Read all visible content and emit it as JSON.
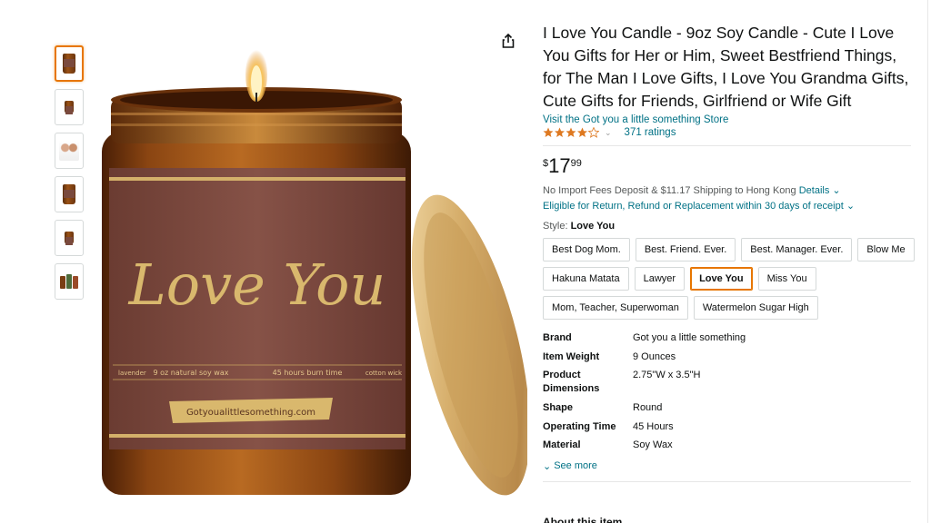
{
  "product": {
    "title": "I Love You Candle - 9oz Soy Candle - Cute I Love You Gifts for Her or Him, Sweet Bestfriend Things, for The Man I Love Gifts, I Love You Grandma Gifts, Cute Gifts for Friends, Girlfriend or Wife Gift",
    "store_link": "Visit the Got you a little something Store",
    "rating_value": 4.5,
    "ratings_count": "371 ratings",
    "price": {
      "currency": "$",
      "whole": "17",
      "fraction": "99"
    },
    "shipping_text": "No Import Fees Deposit & $11.17 Shipping to Hong Kong",
    "shipping_details_link": "Details",
    "returns_text": "Eligible for Return, Refund or Replacement within 30 days of receipt",
    "style_label": "Style:",
    "style_selected": "Love You",
    "style_options": [
      "Best Dog Mom.",
      "Best. Friend. Ever.",
      "Best. Manager. Ever.",
      "Blow Me",
      "Hakuna Matata",
      "Lawyer",
      "Love You",
      "Miss You",
      "Mom, Teacher, Superwoman",
      "Watermelon Sugar High"
    ],
    "specs": [
      {
        "key": "Brand",
        "value": "Got you a little something"
      },
      {
        "key": "Item Weight",
        "value": "9 Ounces"
      },
      {
        "key": "Product Dimensions",
        "value": "2.75\"W x 3.5\"H"
      },
      {
        "key": "Shape",
        "value": "Round"
      },
      {
        "key": "Operating Time",
        "value": "45 Hours"
      },
      {
        "key": "Material",
        "value": "Soy Wax"
      }
    ],
    "see_more": "See more",
    "cut_heading": "About this item"
  },
  "image": {
    "label_script": "Love You",
    "label_small_1": "lavender",
    "label_small_2": "9 oz natural soy wax",
    "label_small_3": "45 hours burn time",
    "label_small_4": "cotton wick",
    "label_website": "Gotyoualittlesomething.com"
  },
  "icons": {
    "share": "share-icon",
    "star": "star-icon",
    "chevron": "chevron-down-icon"
  },
  "colors": {
    "link": "#007185",
    "star": "#de7921",
    "selected_border": "#e77600",
    "amber_glass": "#8a4512",
    "label_brown": "#7d4a3e",
    "gold": "#d4b06a"
  }
}
